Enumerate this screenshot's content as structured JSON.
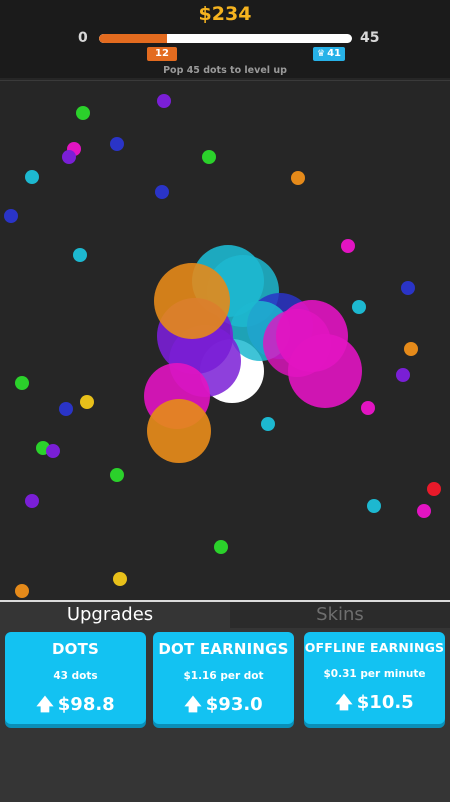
{
  "header": {
    "money": "$234",
    "level_start": "0",
    "level_end": "45",
    "progress": 0.27,
    "current_badge": "12",
    "target_badge": "41",
    "target_icon": "crown-icon",
    "hint": "Pop 45 dots to level up"
  },
  "tabs": [
    {
      "label": "Upgrades",
      "active": true
    },
    {
      "label": "Skins",
      "active": false
    }
  ],
  "cards": {
    "dots": {
      "title": "DOTS",
      "sub": "43 dots",
      "price": "$98.8",
      "icon": "up-arrow-icon"
    },
    "earnings": {
      "title": "DOT EARNINGS",
      "sub": "$1.16 per dot",
      "price": "$93.0",
      "icon": "up-arrow-icon"
    },
    "offline": {
      "title": "OFFLINE EARNINGS",
      "sub": "$0.31 per minute",
      "price": "$10.5",
      "icon": "up-arrow-icon"
    }
  },
  "colors": {
    "money": "#f5b31f",
    "progress_fill": "#e36b1f",
    "target_badge": "#27b2e8",
    "card": "#13c2f2"
  }
}
